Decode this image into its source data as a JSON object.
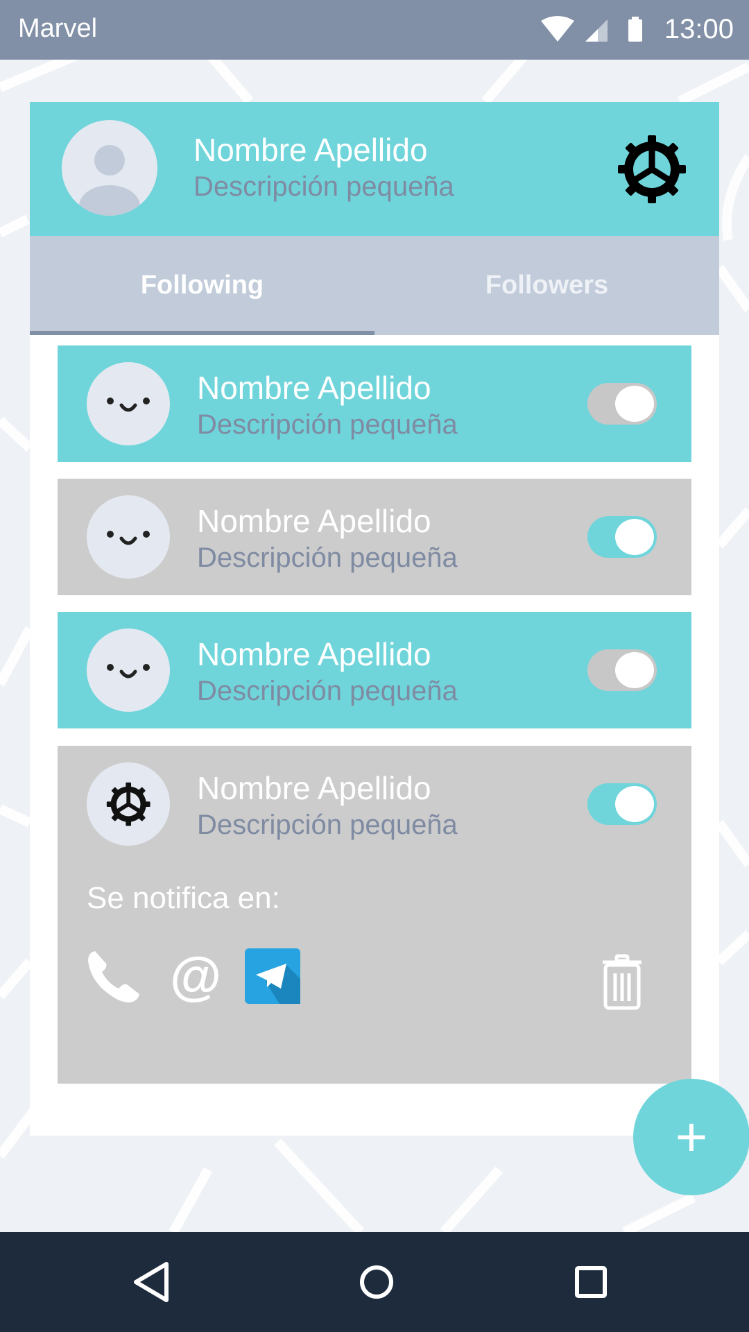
{
  "status_bar": {
    "app_name": "Marvel",
    "time": "13:00"
  },
  "profile": {
    "name": "Nombre Apellido",
    "description": "Descripción pequeña",
    "settings_icon": "gear-icon"
  },
  "tabs": [
    {
      "label": "Following",
      "active": true
    },
    {
      "label": "Followers",
      "active": false
    }
  ],
  "list": [
    {
      "name": "Nombre Apellido",
      "description": "Descripción pequeña",
      "avatar": "smiley-icon",
      "toggle_on": false,
      "bg": "teal"
    },
    {
      "name": "Nombre Apellido",
      "description": "Descripción pequeña",
      "avatar": "smiley-icon",
      "toggle_on": true,
      "bg": "grey"
    },
    {
      "name": "Nombre Apellido",
      "description": "Descripción pequeña",
      "avatar": "smiley-icon",
      "toggle_on": false,
      "bg": "teal"
    },
    {
      "name": "Nombre Apellido",
      "description": "Descripción pequeña",
      "avatar": "gear-icon",
      "toggle_on": true,
      "bg": "grey",
      "notify_label": "Se notifica en:",
      "notify_channels": [
        "phone-icon",
        "at-sign-icon",
        "telegram-icon"
      ],
      "delete_icon": "trash-icon"
    }
  ],
  "fab": {
    "label": "+"
  },
  "at_glyph": "@",
  "colors": {
    "accent": "#6fd5da",
    "status_bar": "#8190a6",
    "nav_bar": "#1e2b3c",
    "tab_bar": "#c1cbd9",
    "muted_text": "#7f8ba2",
    "row_grey": "#cccccc",
    "telegram": "#27a3e1"
  }
}
